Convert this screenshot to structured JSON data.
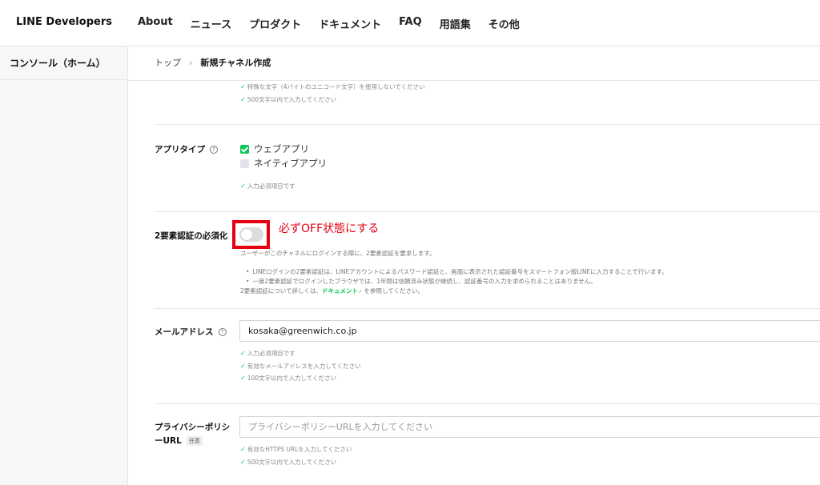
{
  "header": {
    "logo": "LINE Developers",
    "nav": [
      "About",
      "ニュース",
      "プロダクト",
      "ドキュメント",
      "FAQ",
      "用語集",
      "その他"
    ]
  },
  "sidebar": {
    "console_home": "コンソール（ホーム）"
  },
  "breadcrumb": {
    "top": "トップ",
    "separator": "›",
    "current": "新規チャネル作成"
  },
  "hints_top": [
    "特殊な文字（4バイトのユニコード文字）を使用しないでください",
    "500文字以内で入力してください"
  ],
  "app_type": {
    "label": "アプリタイプ",
    "help": "?",
    "options": [
      {
        "label": "ウェブアプリ",
        "checked": true
      },
      {
        "label": "ネイティブアプリ",
        "checked": false
      }
    ],
    "hint": "入力必須項目です"
  },
  "two_factor": {
    "label": "2要素認証の必須化",
    "enabled": false,
    "annotation": "必ずOFF状態にする",
    "description": "ユーザーがこのチャネルにログインする際に、2要素認証を要求します。",
    "bullets": [
      "LINEログインの2要素認証は、LINEアカウントによるパスワード認証と、画面に表示された認証番号をスマートフォン版LINEに入力することで行います。",
      "一度2要素認証でログインしたブラウザでは、1年間は信頼済み状態が継続し、認証番号の入力を求められることはありません。"
    ],
    "more_prefix": "2要素認証について詳しくは、",
    "more_link": "ドキュメント",
    "more_suffix": " を参照してください。"
  },
  "email": {
    "label": "メールアドレス",
    "help": "?",
    "value": "kosaka@greenwich.co.jp",
    "hints": [
      "入力必須項目です",
      "有効なメールアドレスを入力してください",
      "100文字以内で入力してください"
    ]
  },
  "privacy": {
    "label_line1": "プライバシーポリシ",
    "label_line2": "ーURL",
    "optional": "任意",
    "placeholder": "プライバシーポリシーURLを入力してください",
    "hints": [
      "有効なHTTPS URLを入力してください",
      "500文字以内で入力してください"
    ]
  },
  "colors": {
    "accent": "#06c755",
    "annotation": "#e60012"
  },
  "icons": {
    "check": "check-icon",
    "help": "help-circle-icon",
    "external": "external-link-icon"
  }
}
